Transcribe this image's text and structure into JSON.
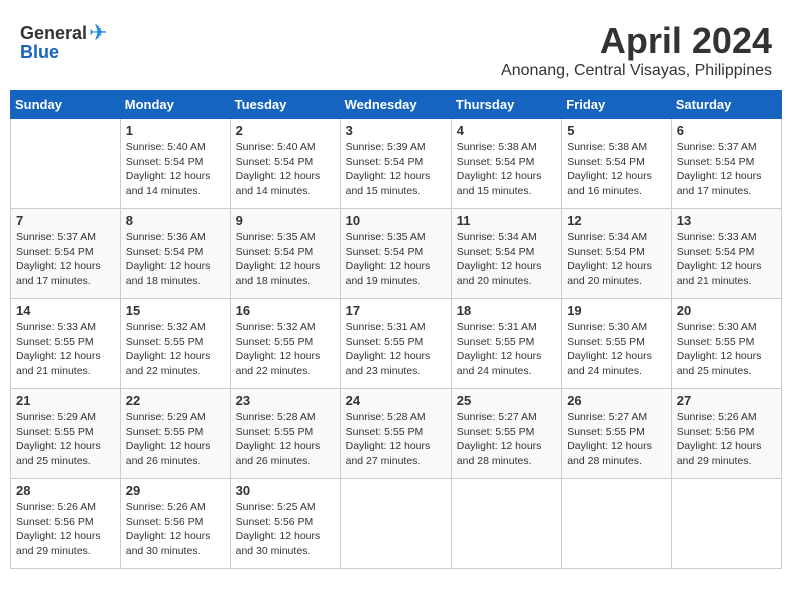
{
  "logo": {
    "general": "General",
    "blue": "Blue"
  },
  "title": {
    "month": "April 2024",
    "location": "Anonang, Central Visayas, Philippines"
  },
  "headers": [
    "Sunday",
    "Monday",
    "Tuesday",
    "Wednesday",
    "Thursday",
    "Friday",
    "Saturday"
  ],
  "weeks": [
    [
      {
        "num": "",
        "info": ""
      },
      {
        "num": "1",
        "info": "Sunrise: 5:40 AM\nSunset: 5:54 PM\nDaylight: 12 hours\nand 14 minutes."
      },
      {
        "num": "2",
        "info": "Sunrise: 5:40 AM\nSunset: 5:54 PM\nDaylight: 12 hours\nand 14 minutes."
      },
      {
        "num": "3",
        "info": "Sunrise: 5:39 AM\nSunset: 5:54 PM\nDaylight: 12 hours\nand 15 minutes."
      },
      {
        "num": "4",
        "info": "Sunrise: 5:38 AM\nSunset: 5:54 PM\nDaylight: 12 hours\nand 15 minutes."
      },
      {
        "num": "5",
        "info": "Sunrise: 5:38 AM\nSunset: 5:54 PM\nDaylight: 12 hours\nand 16 minutes."
      },
      {
        "num": "6",
        "info": "Sunrise: 5:37 AM\nSunset: 5:54 PM\nDaylight: 12 hours\nand 17 minutes."
      }
    ],
    [
      {
        "num": "7",
        "info": "Sunrise: 5:37 AM\nSunset: 5:54 PM\nDaylight: 12 hours\nand 17 minutes."
      },
      {
        "num": "8",
        "info": "Sunrise: 5:36 AM\nSunset: 5:54 PM\nDaylight: 12 hours\nand 18 minutes."
      },
      {
        "num": "9",
        "info": "Sunrise: 5:35 AM\nSunset: 5:54 PM\nDaylight: 12 hours\nand 18 minutes."
      },
      {
        "num": "10",
        "info": "Sunrise: 5:35 AM\nSunset: 5:54 PM\nDaylight: 12 hours\nand 19 minutes."
      },
      {
        "num": "11",
        "info": "Sunrise: 5:34 AM\nSunset: 5:54 PM\nDaylight: 12 hours\nand 20 minutes."
      },
      {
        "num": "12",
        "info": "Sunrise: 5:34 AM\nSunset: 5:54 PM\nDaylight: 12 hours\nand 20 minutes."
      },
      {
        "num": "13",
        "info": "Sunrise: 5:33 AM\nSunset: 5:54 PM\nDaylight: 12 hours\nand 21 minutes."
      }
    ],
    [
      {
        "num": "14",
        "info": "Sunrise: 5:33 AM\nSunset: 5:55 PM\nDaylight: 12 hours\nand 21 minutes."
      },
      {
        "num": "15",
        "info": "Sunrise: 5:32 AM\nSunset: 5:55 PM\nDaylight: 12 hours\nand 22 minutes."
      },
      {
        "num": "16",
        "info": "Sunrise: 5:32 AM\nSunset: 5:55 PM\nDaylight: 12 hours\nand 22 minutes."
      },
      {
        "num": "17",
        "info": "Sunrise: 5:31 AM\nSunset: 5:55 PM\nDaylight: 12 hours\nand 23 minutes."
      },
      {
        "num": "18",
        "info": "Sunrise: 5:31 AM\nSunset: 5:55 PM\nDaylight: 12 hours\nand 24 minutes."
      },
      {
        "num": "19",
        "info": "Sunrise: 5:30 AM\nSunset: 5:55 PM\nDaylight: 12 hours\nand 24 minutes."
      },
      {
        "num": "20",
        "info": "Sunrise: 5:30 AM\nSunset: 5:55 PM\nDaylight: 12 hours\nand 25 minutes."
      }
    ],
    [
      {
        "num": "21",
        "info": "Sunrise: 5:29 AM\nSunset: 5:55 PM\nDaylight: 12 hours\nand 25 minutes."
      },
      {
        "num": "22",
        "info": "Sunrise: 5:29 AM\nSunset: 5:55 PM\nDaylight: 12 hours\nand 26 minutes."
      },
      {
        "num": "23",
        "info": "Sunrise: 5:28 AM\nSunset: 5:55 PM\nDaylight: 12 hours\nand 26 minutes."
      },
      {
        "num": "24",
        "info": "Sunrise: 5:28 AM\nSunset: 5:55 PM\nDaylight: 12 hours\nand 27 minutes."
      },
      {
        "num": "25",
        "info": "Sunrise: 5:27 AM\nSunset: 5:55 PM\nDaylight: 12 hours\nand 28 minutes."
      },
      {
        "num": "26",
        "info": "Sunrise: 5:27 AM\nSunset: 5:55 PM\nDaylight: 12 hours\nand 28 minutes."
      },
      {
        "num": "27",
        "info": "Sunrise: 5:26 AM\nSunset: 5:56 PM\nDaylight: 12 hours\nand 29 minutes."
      }
    ],
    [
      {
        "num": "28",
        "info": "Sunrise: 5:26 AM\nSunset: 5:56 PM\nDaylight: 12 hours\nand 29 minutes."
      },
      {
        "num": "29",
        "info": "Sunrise: 5:26 AM\nSunset: 5:56 PM\nDaylight: 12 hours\nand 30 minutes."
      },
      {
        "num": "30",
        "info": "Sunrise: 5:25 AM\nSunset: 5:56 PM\nDaylight: 12 hours\nand 30 minutes."
      },
      {
        "num": "",
        "info": ""
      },
      {
        "num": "",
        "info": ""
      },
      {
        "num": "",
        "info": ""
      },
      {
        "num": "",
        "info": ""
      }
    ]
  ]
}
